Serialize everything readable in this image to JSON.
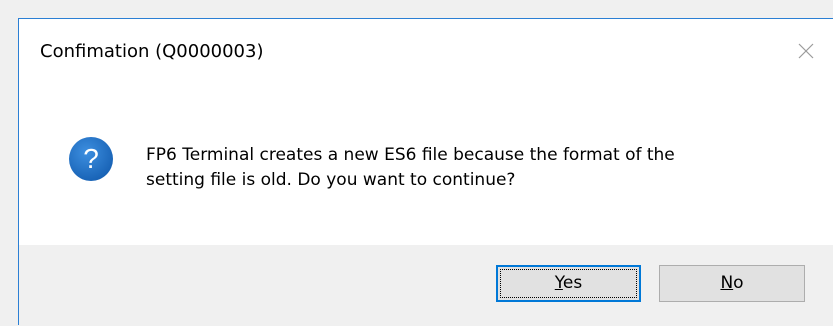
{
  "dialog": {
    "title": "Confimation (Q0000003)",
    "message_line1": "FP6 Terminal creates a new ES6 file because the format of the",
    "message_line2": "setting file is old. Do you want to continue?",
    "icon": "question-icon"
  },
  "buttons": {
    "yes": {
      "mnemonic": "Y",
      "rest": "es"
    },
    "no": {
      "mnemonic": "N",
      "rest": "o"
    }
  },
  "colors": {
    "accent": "#0078d7",
    "border": "#2b7fd4",
    "icon_blue": "#1f6fbf",
    "footer_bg": "#f0f0f0",
    "button_bg": "#e1e1e1"
  }
}
